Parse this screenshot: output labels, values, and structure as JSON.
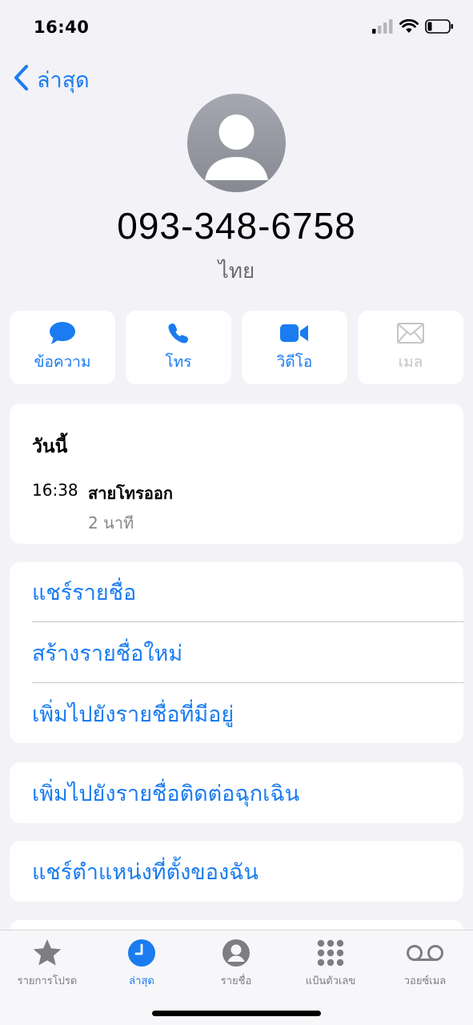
{
  "status_bar": {
    "time": "16:40"
  },
  "nav": {
    "back_label": "ล่าสุด"
  },
  "contact": {
    "number": "093-348-6758",
    "label": "ไทย"
  },
  "actions": [
    {
      "label": "ข้อความ",
      "icon": "message-icon",
      "enabled": true
    },
    {
      "label": "โทร",
      "icon": "phone-icon",
      "enabled": true
    },
    {
      "label": "วิดีโอ",
      "icon": "video-icon",
      "enabled": true
    },
    {
      "label": "เมล",
      "icon": "mail-icon",
      "enabled": false
    }
  ],
  "recents": {
    "day": "วันนี้",
    "time": "16:38",
    "type": "สายโทรออก",
    "duration": "2 นาที"
  },
  "contact_options": [
    "แชร์รายชื่อ",
    "สร้างรายชื่อใหม่",
    "เพิ่มไปยังรายชื่อที่มีอยู่"
  ],
  "emergency_option": "เพิ่มไปยังรายชื่อติดต่อฉุกเฉิน",
  "share_location_option": "แชร์ตำแหน่งที่ตั้งของฉัน",
  "tabs": [
    {
      "label": "รายการโปรด",
      "icon": "star-icon",
      "active": false
    },
    {
      "label": "ล่าสุด",
      "icon": "clock-icon",
      "active": true
    },
    {
      "label": "รายชื่อ",
      "icon": "person-circle-icon",
      "active": false
    },
    {
      "label": "แป้นตัวเลข",
      "icon": "keypad-icon",
      "active": false
    },
    {
      "label": "วอยซ์เมล",
      "icon": "voicemail-icon",
      "active": false
    }
  ],
  "colors": {
    "accent": "#1a7cf0",
    "background": "#f2f2f7",
    "disabled": "#c5c5c9"
  }
}
